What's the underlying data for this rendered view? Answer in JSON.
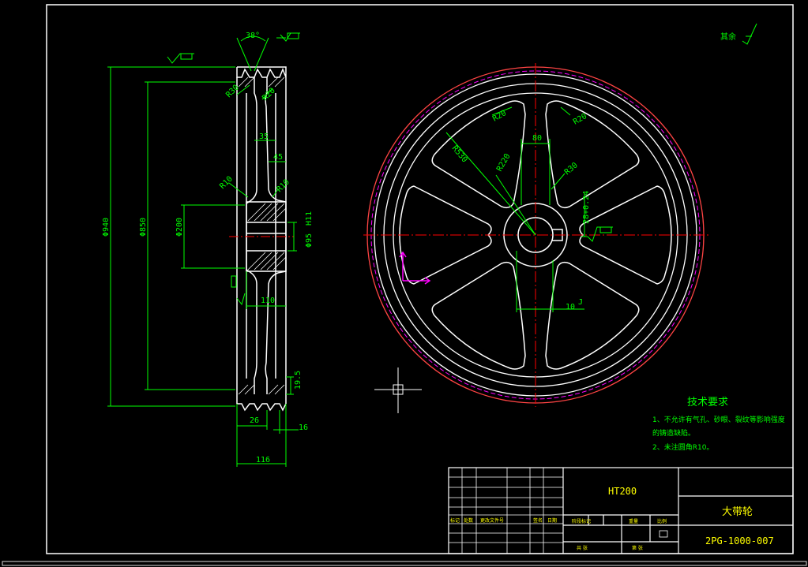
{
  "colors": {
    "background": "#000000",
    "outline": "#ffffff",
    "dimension": "#00ff00",
    "centerline": "#ff0000",
    "hidden": "#ff00ff",
    "text_green": "#00ff00",
    "text_yellow": "#ffff00",
    "hatch": "#ffffff"
  },
  "side_view": {
    "angle": "38°",
    "diameters": {
      "outer": "Φ940",
      "inner": "Φ850",
      "hub": "Φ200",
      "bore": "Φ95"
    },
    "fillets": {
      "r1": "R30",
      "r2": "R20",
      "r3": "R10",
      "r4": "R10"
    },
    "widths": {
      "w35": "35",
      "w45": "45",
      "w110": "110",
      "w26": "26",
      "w16": "16",
      "w116": "116",
      "h195": "19.5"
    },
    "tolerance": "H11"
  },
  "front_view": {
    "dims": {
      "d80": "80",
      "r530": "R530",
      "r220": "R220",
      "r20a": "R20",
      "r20b": "R20",
      "r30": "R30",
      "key": "28+0.24",
      "keywidth": "10",
      "tol": "J"
    }
  },
  "roughness_note": "其余",
  "tech_requirements": {
    "title": "技术要求",
    "item1_line1": "1、不允许有气孔、砂眼、裂纹等影响强度",
    "item1_line2": "的铸造缺陷。",
    "item2": "2、未注圆角R10。"
  },
  "title_block": {
    "material": "HT200",
    "part_name": "大带轮",
    "drawing_no": "2PG-1000-007",
    "labels": {
      "mark": "标记",
      "count": "处数",
      "zone": "更改文件号",
      "sign": "签名",
      "date": "日期",
      "stage": "阶段标记",
      "weight": "重量",
      "scale": "比例",
      "sheets": "共 张",
      "sheet": "第 张"
    }
  }
}
